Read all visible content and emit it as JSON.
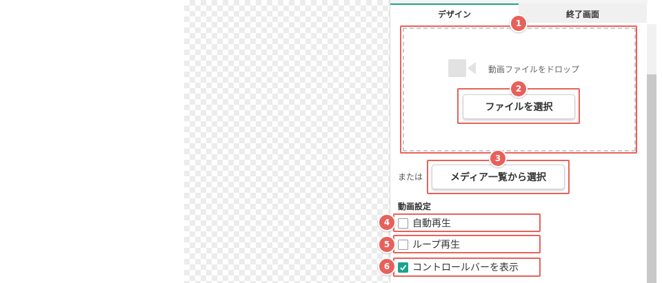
{
  "tabs": [
    {
      "label": "デザイン",
      "active": true
    },
    {
      "label": "終了画面",
      "active": false
    }
  ],
  "dropzone": {
    "text": "動画ファイルをドロップ",
    "icon": "video-camera-icon"
  },
  "buttons": {
    "file_select": "ファイルを選択",
    "or_text": "または",
    "media_select": "メディア一覧から選択"
  },
  "video_settings": {
    "title": "動画設定",
    "options": [
      {
        "label": "自動再生",
        "checked": false
      },
      {
        "label": "ループ再生",
        "checked": false
      },
      {
        "label": "コントロールバーを表示",
        "checked": true
      }
    ]
  },
  "annotations": [
    "1",
    "2",
    "3",
    "4",
    "5",
    "6"
  ],
  "colors": {
    "accent": "#1aa38c",
    "annotation": "#e8605a"
  }
}
